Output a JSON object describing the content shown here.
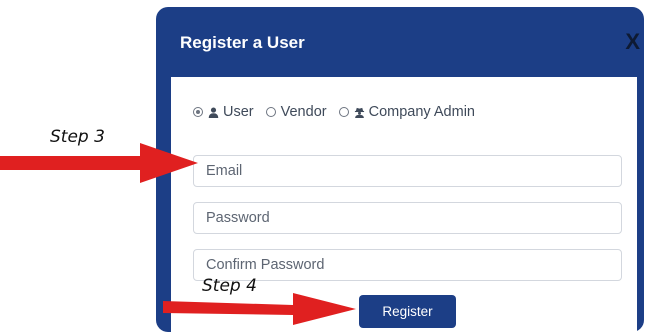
{
  "modal": {
    "title": "Register a User",
    "close_label": "X"
  },
  "roles": [
    {
      "label": "User",
      "selected": true,
      "icon": "user-icon"
    },
    {
      "label": "Vendor",
      "selected": false,
      "icon": null
    },
    {
      "label": "Company Admin",
      "selected": false,
      "icon": "user-secret-icon"
    }
  ],
  "form": {
    "email_placeholder": "Email",
    "password_placeholder": "Password",
    "confirm_password_placeholder": "Confirm Password",
    "register_label": "Register"
  },
  "annotations": {
    "step3": "Step 3",
    "step4": "Step 4",
    "arrow_color": "#e02020"
  },
  "colors": {
    "primary": "#1c3e86"
  }
}
